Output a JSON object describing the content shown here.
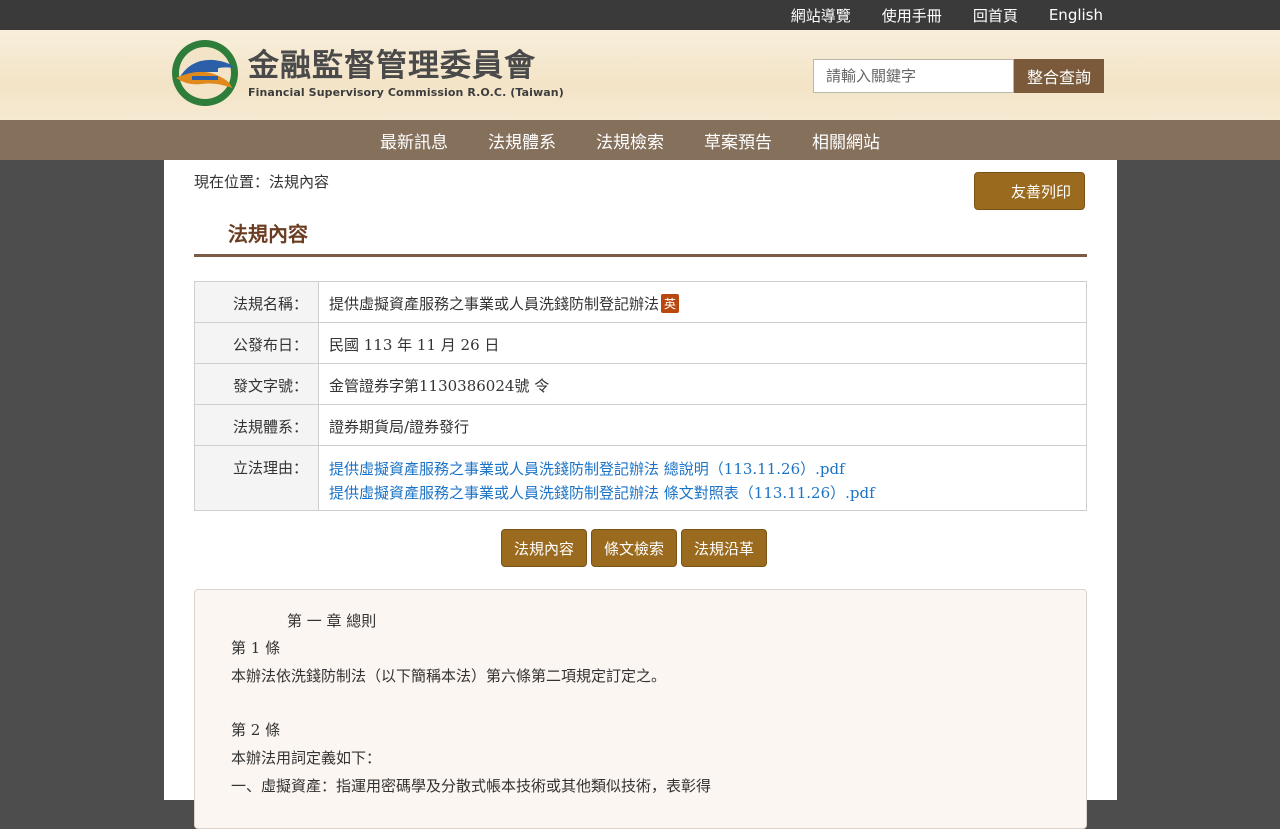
{
  "topbar": {
    "links": [
      "網站導覽",
      "使用手冊",
      "回首頁",
      "English"
    ]
  },
  "header": {
    "logo_zh": "金融監督管理委員會",
    "logo_en": "Financial Supervisory Commission R.O.C. (Taiwan)",
    "search_placeholder": "請輸入關鍵字",
    "search_button": "整合查詢"
  },
  "nav": {
    "items": [
      "最新訊息",
      "法規體系",
      "法規檢索",
      "草案預告",
      "相關網站"
    ]
  },
  "breadcrumb": "現在位置：法規內容",
  "print_button": "友善列印",
  "page_title": "法規內容",
  "info": {
    "name_label": "法規名稱：",
    "name_value": "提供虛擬資產服務之事業或人員洗錢防制登記辦法",
    "name_badge": "英",
    "date_label": "公發布日：",
    "date_value": "民國 113 年 11 月 26 日",
    "docno_label": "發文字號：",
    "docno_value": "金管證券字第1130386024號 令",
    "system_label": "法規體系：",
    "system_value": "證券期貨局/證券發行",
    "reason_label": "立法理由：",
    "reason_links": [
      "提供虛擬資產服務之事業或人員洗錢防制登記辦法 總說明（113.11.26）.pdf",
      "提供虛擬資產服務之事業或人員洗錢防制登記辦法 條文對照表（113.11.26）.pdf"
    ]
  },
  "tabs": [
    "法規內容",
    "條文檢索",
    "法規沿革"
  ],
  "content": {
    "chapter": "第 一 章 總則",
    "art1_no": "第 1 條",
    "art1_text": "本辦法依洗錢防制法（以下簡稱本法）第六條第二項規定訂定之。",
    "art2_no": "第 2 條",
    "art2_text": "本辦法用詞定義如下：",
    "art2_item1": "一、虛擬資產：指運用密碼學及分散式帳本技術或其他類似技術，表彰得"
  },
  "colors": {
    "accent": "#9a6a1f",
    "nav_bg": "#85705c",
    "title": "#6b3d22",
    "link": "#1a73c7",
    "badge": "#b9480f"
  }
}
